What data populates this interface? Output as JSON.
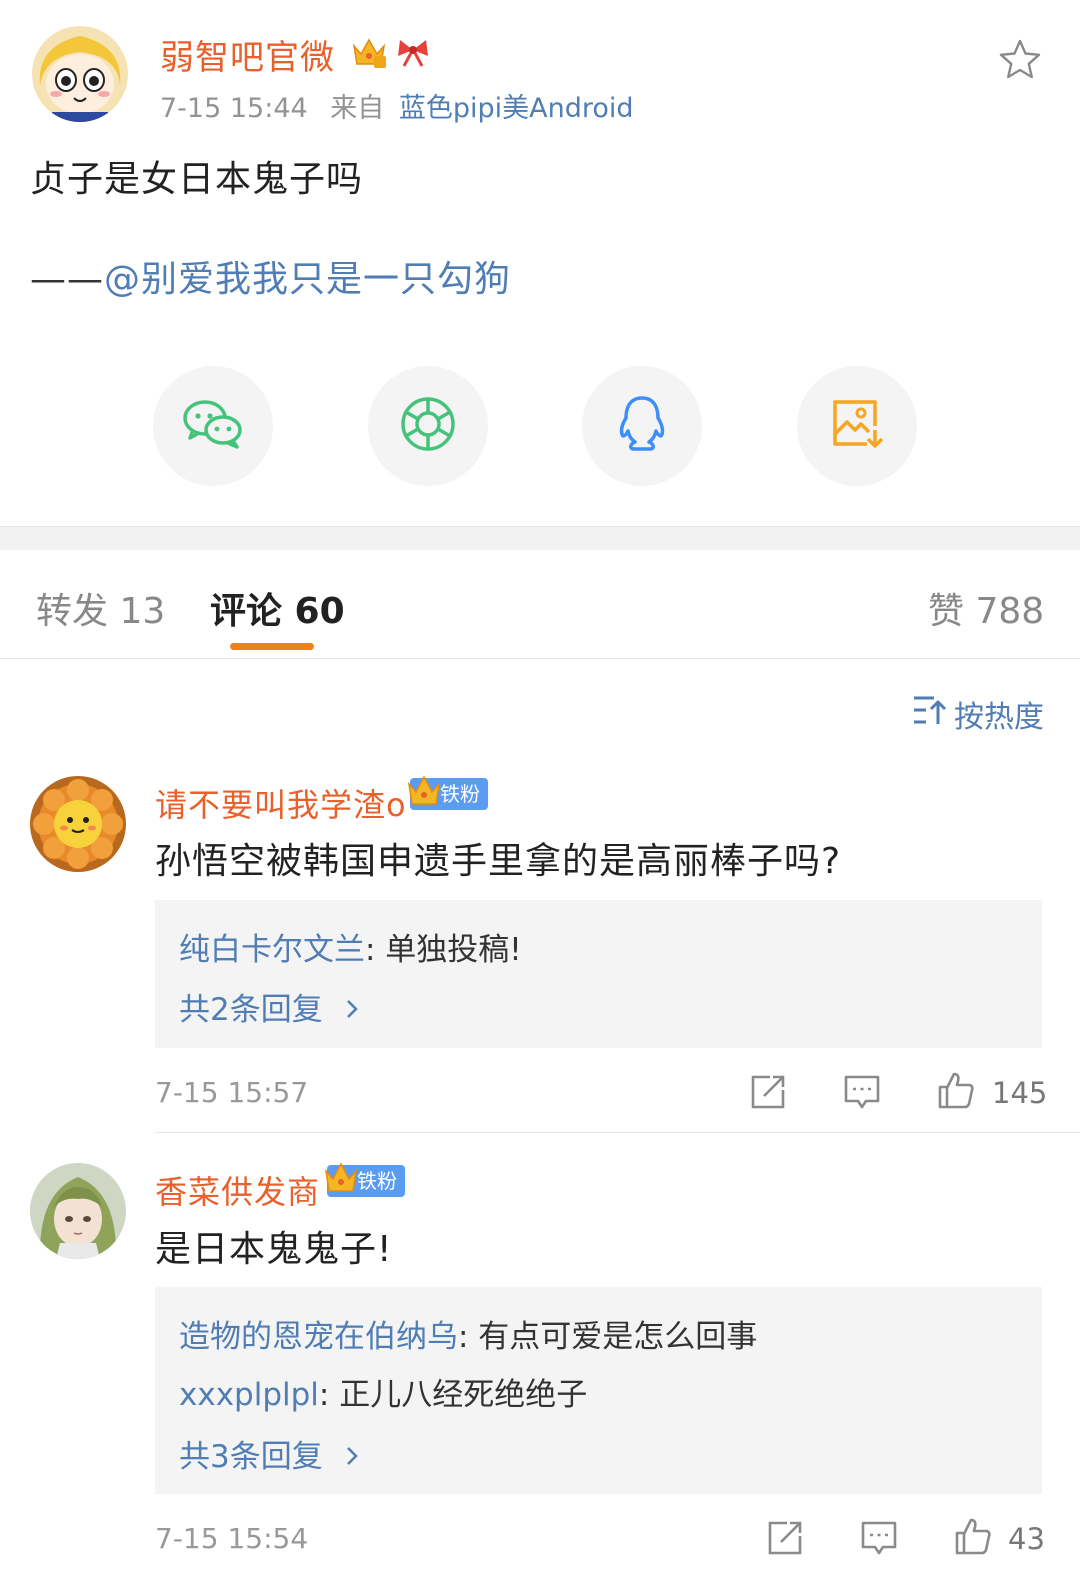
{
  "post": {
    "author": "弱智吧官微",
    "time": "7-15 15:44",
    "from_label": "来自",
    "source": "蓝色pipi美Android",
    "text": "贞子是女日本鬼子吗",
    "credit_dash": "——",
    "credit_mention": "@别爱我我只是一只勾狗"
  },
  "share": {
    "icons": [
      "wechat-icon",
      "moments-icon",
      "qq-icon",
      "save-image-icon"
    ],
    "colors": {
      "wechat": "#45c37a",
      "moments": "#45c37a",
      "qq": "#3e8ef7",
      "save": "#f5a623"
    }
  },
  "tabs": {
    "repost": "转发 13",
    "comments": "评论 60",
    "likes": "赞 788"
  },
  "sort": {
    "label": "按热度"
  },
  "comments": [
    {
      "user": "请不要叫我学渣o",
      "badge": "铁粉",
      "text": "孙悟空被韩国申遗手里拿的是高丽棒子吗?",
      "replies": [
        {
          "user": "纯白卡尔文兰",
          "text": ": 单独投稿!"
        }
      ],
      "more": "共2条回复",
      "time": "7-15 15:57",
      "likes": "145"
    },
    {
      "user": "香菜供发商",
      "badge": "铁粉",
      "text": "是日本鬼鬼子!",
      "replies": [
        {
          "user": "造物的恩宠在伯纳乌",
          "text": ": 有点可爱是怎么回事"
        },
        {
          "user": "xxxplplpl",
          "text": ": 正儿八经死绝绝子"
        }
      ],
      "more": "共3条回复",
      "time": "7-15 15:54",
      "likes": "43"
    }
  ],
  "colors": {
    "username": "#e8612c",
    "link": "#4f7db4",
    "tab_accent": "#f08019",
    "fan_badge": "#5a9cf0"
  }
}
